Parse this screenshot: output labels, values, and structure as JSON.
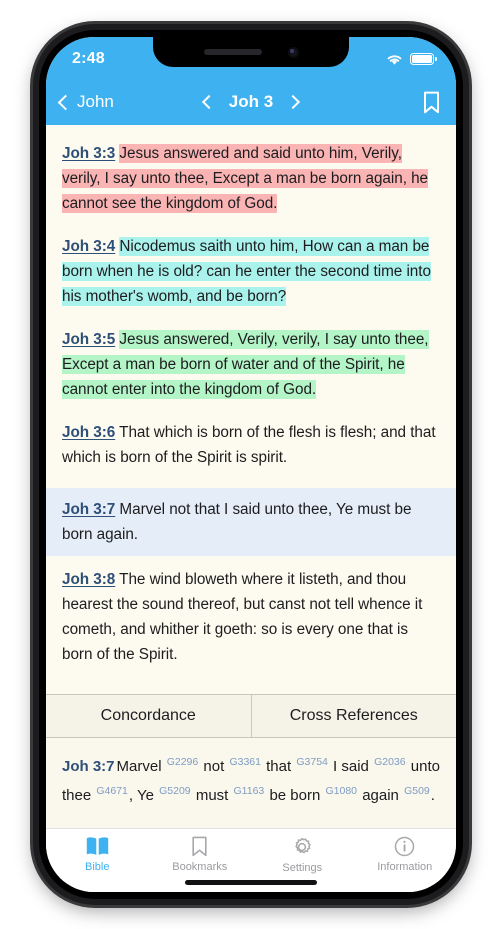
{
  "statusbar": {
    "time": "2:48",
    "wifi_icon": "wifi-icon",
    "battery_icon": "battery-full-icon"
  },
  "navbar": {
    "back_label": "John",
    "back_icon": "chevron-left-icon",
    "prev_icon": "chevron-left-icon",
    "chapter_label": "Joh 3",
    "next_icon": "chevron-right-icon",
    "bookmark_icon": "bookmark-icon",
    "bar_color": "#3eb1f0"
  },
  "reader": {
    "background": "#fdfaef",
    "verses": [
      {
        "ref": "Joh 3:3",
        "text": "Jesus answered and said unto him, Verily, verily, I say unto thee, Except a man be born again, he cannot see the kingdom of God.",
        "highlight": "#fab4b4",
        "selected": false
      },
      {
        "ref": "Joh 3:4",
        "text": "Nicodemus saith unto him, How can a man be born when he is old? can he enter the second time into his mother's womb, and be born?",
        "lead_plain": "Nicodemus saith unto him, ",
        "highlight": "#aaf2ec",
        "selected": false
      },
      {
        "ref": "Joh 3:5",
        "text": "Jesus answered, Verily, verily, I say unto thee, Except a man be born of water and of the Spirit, he cannot enter into the kingdom of God.",
        "highlight": "#b4f5c8",
        "selected": false
      },
      {
        "ref": "Joh 3:6",
        "text": "That which is born of the flesh is flesh; and that which is born of the Spirit is spirit.",
        "highlight": "",
        "selected": false
      },
      {
        "ref": "Joh 3:7",
        "text": "Marvel not that I said unto thee, Ye must be born again.",
        "highlight": "",
        "selected": true,
        "selection_color": "#e4edf8"
      },
      {
        "ref": "Joh 3:8",
        "text": "The wind bloweth where it listeth, and thou hearest the sound thereof, but canst not tell whence it cometh, and whither it goeth: so is every one that is born of the Spirit.",
        "highlight": "",
        "selected": false
      }
    ]
  },
  "panel_tabs": {
    "active_index": 0,
    "items": [
      {
        "label": "Concordance"
      },
      {
        "label": "Cross References"
      }
    ]
  },
  "concordance": {
    "ref": "Joh 3:7",
    "tokens": [
      {
        "word": "Marvel",
        "strong": "G2296"
      },
      {
        "word": "not",
        "strong": "G3361"
      },
      {
        "word": "that",
        "strong": "G3754"
      },
      {
        "word": "I said",
        "strong": "G2036"
      },
      {
        "word": "unto thee",
        "strong": "G4671"
      },
      {
        "word": ", Ye",
        "strong": "G5209"
      },
      {
        "word": "must",
        "strong": "G1163"
      },
      {
        "word": "be born",
        "strong": "G1080"
      },
      {
        "word": "again",
        "strong": "G509"
      },
      {
        "word": ".",
        "strong": ""
      }
    ]
  },
  "tabbar": {
    "active_index": 0,
    "active_color": "#3eb1f0",
    "inactive_color": "#9b9b9f",
    "items": [
      {
        "label": "Bible",
        "icon": "open-book-icon"
      },
      {
        "label": "Bookmarks",
        "icon": "bookmark-icon"
      },
      {
        "label": "Settings",
        "icon": "gear-icon"
      },
      {
        "label": "Information",
        "icon": "info-circle-icon"
      }
    ]
  }
}
